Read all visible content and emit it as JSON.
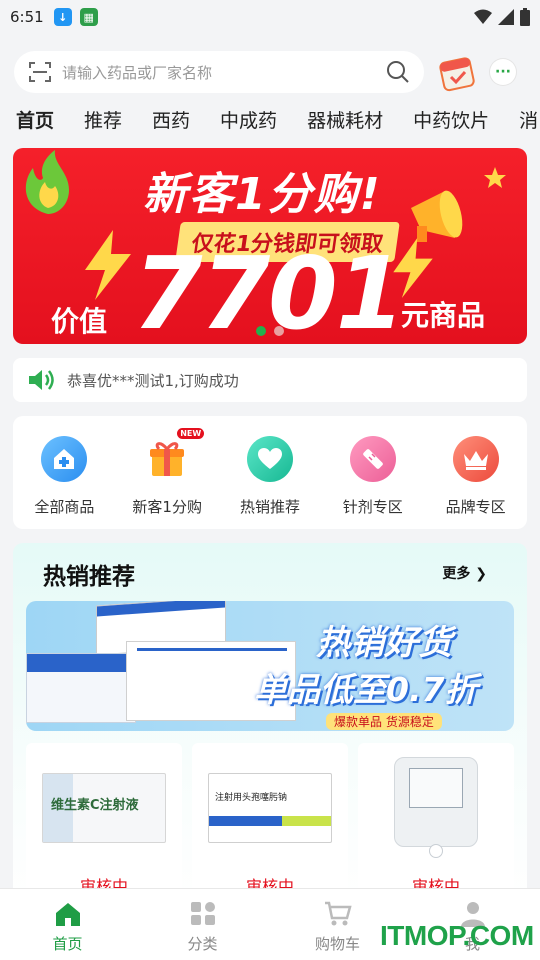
{
  "status_bar": {
    "time": "6:51"
  },
  "search": {
    "placeholder": "请输入药品或厂家名称"
  },
  "tabs": [
    "首页",
    "推荐",
    "西药",
    "中成药",
    "器械耗材",
    "中药饮片",
    "消"
  ],
  "banner": {
    "headline": "新客1分购!",
    "subline": "仅花1分钱即可领取",
    "price_label": "价值",
    "price": "7701",
    "price_suffix": "元商品",
    "slides": 2,
    "active_slide": 1
  },
  "notice": {
    "text": "恭喜优***测试1,订购成功"
  },
  "categories": [
    {
      "label": "全部商品",
      "icon": "hospital-icon",
      "color": "#3aa1f2"
    },
    {
      "label": "新客1分购",
      "icon": "gift-icon",
      "color": "#f5a623",
      "badge": "NEW"
    },
    {
      "label": "热销推荐",
      "icon": "heart-icon",
      "color": "#20c9a6"
    },
    {
      "label": "针剂专区",
      "icon": "syringe-icon",
      "color": "#f06a9b"
    },
    {
      "label": "品牌专区",
      "icon": "crown-icon",
      "color": "#f0574a"
    }
  ],
  "hot_section": {
    "title": "热销推荐",
    "more": "更多",
    "banner_line1": "热销好货",
    "banner_line2": "单品低至0.7折",
    "banner_line3": "爆款单品 货源稳定",
    "products": [
      {
        "status": "审核中",
        "name_on_box": "维生素C注射液"
      },
      {
        "status": "审核中",
        "name_on_box": "注射用头孢噻肟钠"
      },
      {
        "status": "审核中",
        "name_on_box": ""
      }
    ]
  },
  "bottom_nav": [
    {
      "label": "首页",
      "icon": "home-icon",
      "active": true
    },
    {
      "label": "分类",
      "icon": "grid-icon",
      "active": false
    },
    {
      "label": "购物车",
      "icon": "cart-icon",
      "active": false
    },
    {
      "label": "我",
      "icon": "user-icon",
      "active": false
    }
  ],
  "watermark": "ITMOP.COM",
  "colors": {
    "brand_green": "#1f9d45",
    "banner_red": "#e4101e",
    "alert_red": "#e4101e"
  }
}
